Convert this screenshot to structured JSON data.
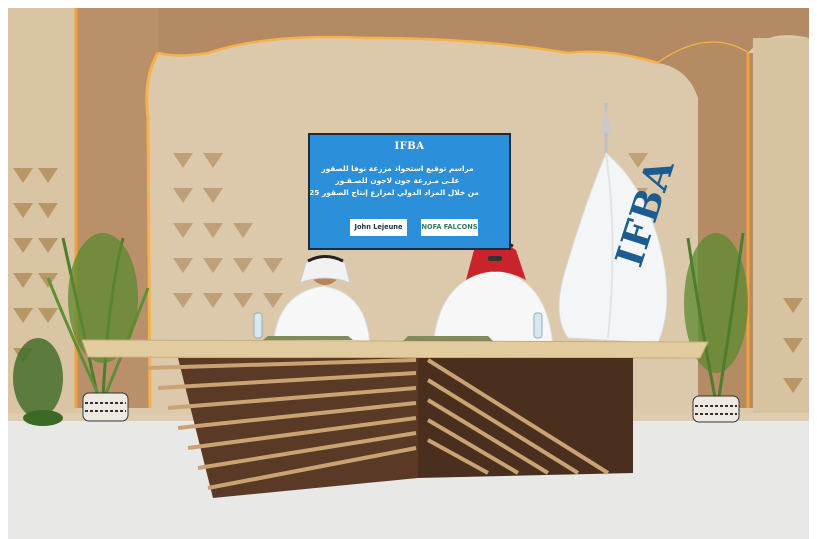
{
  "screen": {
    "logo": "IFBA",
    "line1": "مراسم توقيع استحواذ مزرعة نوفا للصقور",
    "line2": "علـى مـزرعة جون لاجون للصـقـور",
    "line3": "من خلال المزاد الدولي لمزارع إنتاج الصقور 2025",
    "left_name": "John Lejeune",
    "right_name": "NOFA FALCONS"
  },
  "flag": {
    "text": "IFBA"
  },
  "colors": {
    "wall": "#dccbb0",
    "screen_blue": "#2b8fd9",
    "table_top": "#e3cba0",
    "carpet": "#e9eae9"
  }
}
